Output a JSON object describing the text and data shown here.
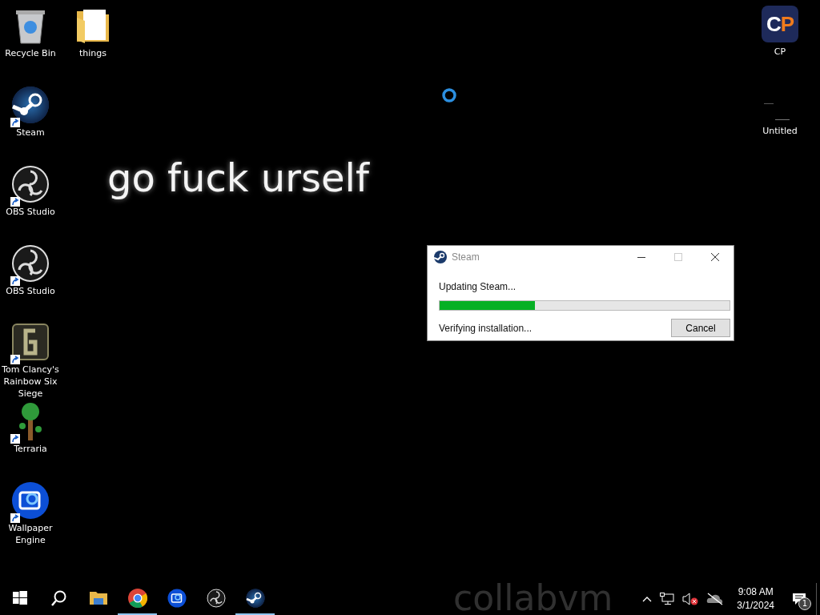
{
  "desktop_icons": [
    {
      "label": "Recycle Bin",
      "kind": "recycle",
      "shortcut": false
    },
    {
      "label": "things",
      "kind": "folder",
      "shortcut": false
    },
    {
      "label": "Steam",
      "kind": "steam",
      "shortcut": true
    },
    {
      "label": "OBS Studio",
      "kind": "obs",
      "shortcut": true
    },
    {
      "label": "OBS Studio",
      "kind": "obs",
      "shortcut": true
    },
    {
      "label": "Tom Clancy's Rainbow Six Siege",
      "kind": "six",
      "shortcut": true
    },
    {
      "label": "Terraria",
      "kind": "tree",
      "shortcut": true
    },
    {
      "label": "Wallpaper Engine",
      "kind": "wallpaper",
      "shortcut": true
    },
    {
      "label": "CP",
      "kind": "cp",
      "logo_text": "CP",
      "shortcut": false
    },
    {
      "label": "Untitled",
      "kind": "blank",
      "shortcut": false
    }
  ],
  "wallpaper_texts": [
    "go fuck urself",
    "collabvm"
  ],
  "dialog": {
    "title": "Steam",
    "status": "Updating Steam...",
    "progress": {
      "level": 0.33
    },
    "detail": "Verifying installation...",
    "button": "Cancel",
    "maximize_disabled": true
  },
  "taskbar": {
    "apps": [
      {
        "kind": "start",
        "running": false
      },
      {
        "kind": "search",
        "running": false
      },
      {
        "kind": "explorer",
        "running": false
      },
      {
        "kind": "chrome",
        "running": true
      },
      {
        "kind": "wallpaper",
        "running": false
      },
      {
        "kind": "obs",
        "running": false
      },
      {
        "kind": "steam",
        "running": true
      }
    ],
    "tray": {
      "time": "9:08 AM",
      "date": "3/1/2024",
      "notifications": "1",
      "volume_muted": true
    }
  }
}
